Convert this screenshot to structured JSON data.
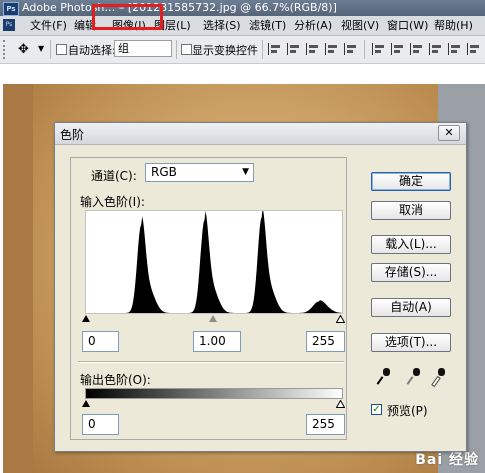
{
  "app": {
    "title": "Adobe Photosh… – [201281585732.jpg @ 66.7%(RGB/8)]",
    "logo": "Ps"
  },
  "menu": {
    "items": [
      "文件(F)",
      "编辑",
      "图像(I)",
      "图层(L)",
      "选择(S)",
      "滤镜(T)",
      "分析(A)",
      "视图(V)",
      "窗口(W)",
      "帮助(H)"
    ]
  },
  "options_bar": {
    "auto_select_label": "自动选择:",
    "auto_select_checked": false,
    "group_value": "组",
    "show_transform_label": "显示变换控件",
    "show_transform_checked": false
  },
  "levels_dialog": {
    "title": "色阶",
    "close_label": "✕",
    "channel_label": "通道(C):",
    "channel_value": "RGB",
    "input_levels_label": "输入色阶(I):",
    "input_black": "0",
    "input_gray": "1.00",
    "input_white": "255",
    "output_levels_label": "输出色阶(O):",
    "output_black": "0",
    "output_white": "255",
    "buttons": {
      "ok": "确定",
      "cancel": "取消",
      "load": "载入(L)...",
      "save": "存储(S)...",
      "auto": "自动(A)",
      "options": "选项(T)..."
    },
    "preview_label": "预览(P)",
    "preview_checked": true
  },
  "histogram": {
    "peaks": [
      {
        "level": 55,
        "height": 0.92
      },
      {
        "level": 118,
        "height": 0.97
      },
      {
        "level": 175,
        "height": 1.0
      },
      {
        "level": 232,
        "height": 0.12
      }
    ]
  },
  "watermark": "Bai 经验"
}
